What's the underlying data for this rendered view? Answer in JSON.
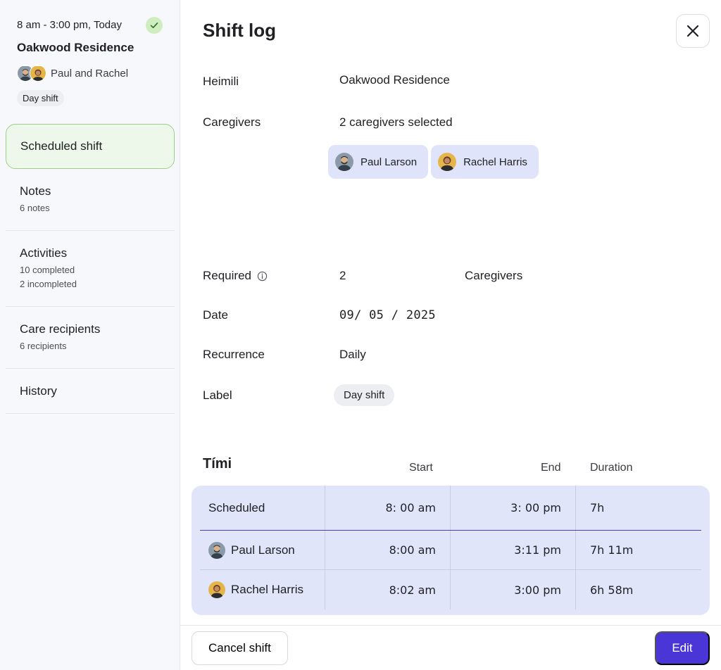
{
  "sidebar": {
    "time": "8 am - 3:00 pm,  Today",
    "place": "Oakwood Residence",
    "people_label": "Paul and Rachel",
    "shift_chip": "Day shift",
    "items": [
      {
        "title": "Scheduled shift"
      },
      {
        "title": "Notes",
        "sub": [
          "6 notes"
        ]
      },
      {
        "title": "Activities",
        "sub": [
          "10 completed",
          "2 incompleted"
        ]
      },
      {
        "title": "Care recipients",
        "sub": [
          "6 recipients"
        ]
      },
      {
        "title": "History"
      }
    ]
  },
  "main": {
    "title": "Shift log",
    "fields": {
      "home_label": "Heimili",
      "home_value": "Oakwood Residence",
      "caregivers_label": "Caregivers",
      "caregivers_value": "2 caregivers selected",
      "required_label": "Required",
      "required_value": "2",
      "required_unit": "Caregivers",
      "date_label": "Date",
      "date_value": "09/ 05 / 2025",
      "recurrence_label": "Recurrence",
      "recurrence_value": "Daily",
      "label_label": "Label",
      "label_value": "Day shift"
    },
    "caregivers": [
      {
        "name": "Paul Larson"
      },
      {
        "name": "Rachel Harris"
      }
    ]
  },
  "times": {
    "title": "Tími",
    "columns": {
      "start": "Start",
      "end": "End",
      "duration": "Duration"
    },
    "rows": [
      {
        "name": "Scheduled",
        "start": "8: 00 am",
        "end": "3: 00 pm",
        "duration": "7h"
      },
      {
        "name": "Paul Larson",
        "start": "8:00 am",
        "end": "3:11 pm",
        "duration": "7h 11m"
      },
      {
        "name": "Rachel Harris",
        "start": "8:02 am",
        "end": "3:00 pm",
        "duration": "6h 58m"
      }
    ]
  },
  "footer": {
    "cancel_label": "Cancel shift",
    "edit_label": "Edit"
  },
  "colors": {
    "accent": "#4a36d6",
    "active_nav_bg": "#eef8ea",
    "active_nav_border": "#9ccf8b",
    "times_card_bg": "#e0e5fa",
    "check_bg": "#cfeec0"
  }
}
